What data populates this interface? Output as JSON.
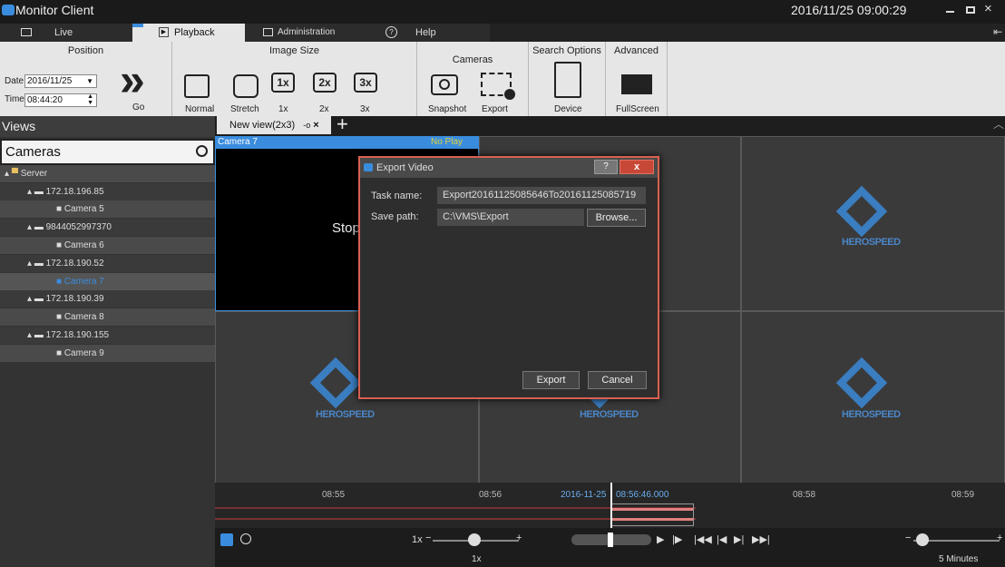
{
  "app": {
    "title": "Monitor Client",
    "datetime": "2016/11/25 09:00:29",
    "min_icon": "minimize-icon",
    "max_icon": "maximize-icon",
    "close_icon": "close-icon"
  },
  "tabs": [
    {
      "label": "Live"
    },
    {
      "label": "Playback",
      "active": true
    },
    {
      "label": "Administration"
    },
    {
      "label": "Help"
    }
  ],
  "ribbon": {
    "position": {
      "title": "Position",
      "date_label": "Date",
      "date_value": "2016/11/25",
      "time_label": "Time",
      "time_value": "08:44:20",
      "go_label": "Go"
    },
    "image_size": {
      "title": "Image Size",
      "normal": "Normal",
      "stretch": "Stretch",
      "x1_icon": "1x",
      "x1": "1x",
      "x2_icon": "2x",
      "x2": "2x",
      "x3_icon": "3x",
      "x3": "3x"
    },
    "cameras": {
      "title": "Cameras",
      "snapshot": "Snapshot",
      "export": "Export"
    },
    "search": {
      "title": "Search Options",
      "device": "Device"
    },
    "advanced": {
      "title": "Advanced",
      "fullscreen": "FullScreen"
    }
  },
  "sidebar": {
    "header": "Views",
    "search_value": "Cameras",
    "tree": [
      {
        "label": "Server"
      },
      {
        "label": "172.18.196.85"
      },
      {
        "label": "Camera 5"
      },
      {
        "label": "9844052997370"
      },
      {
        "label": "Camera 6"
      },
      {
        "label": "172.18.190.52"
      },
      {
        "label": "Camera 7"
      },
      {
        "label": "172.18.190.39"
      },
      {
        "label": "Camera 8"
      },
      {
        "label": "172.18.190.155"
      },
      {
        "label": "Camera 9"
      }
    ]
  },
  "view": {
    "tab_label": "New view(2x3)",
    "tab_mark": "-o",
    "camera_label": "Camera 7",
    "status": "No Play",
    "stop_text": "Stop",
    "logo_text": "HEROSPEED"
  },
  "dialog": {
    "title": "Export Video",
    "help": "?",
    "close": "x",
    "task_label": "Task name:",
    "task_value": "Export20161125085646To20161125085719",
    "path_label": "Save path:",
    "path_value": "C:\\VMS\\Export",
    "browse": "Browse...",
    "export": "Export",
    "cancel": "Cancel"
  },
  "timeline": {
    "ticks": [
      "08:55",
      "08:56",
      "08:58",
      "08:59"
    ],
    "cursor_date": "2016-11-25",
    "cursor_time": "08:56:46.000"
  },
  "controls": {
    "speed": "1x",
    "speed_below": "1x",
    "span": "5 Minutes"
  }
}
